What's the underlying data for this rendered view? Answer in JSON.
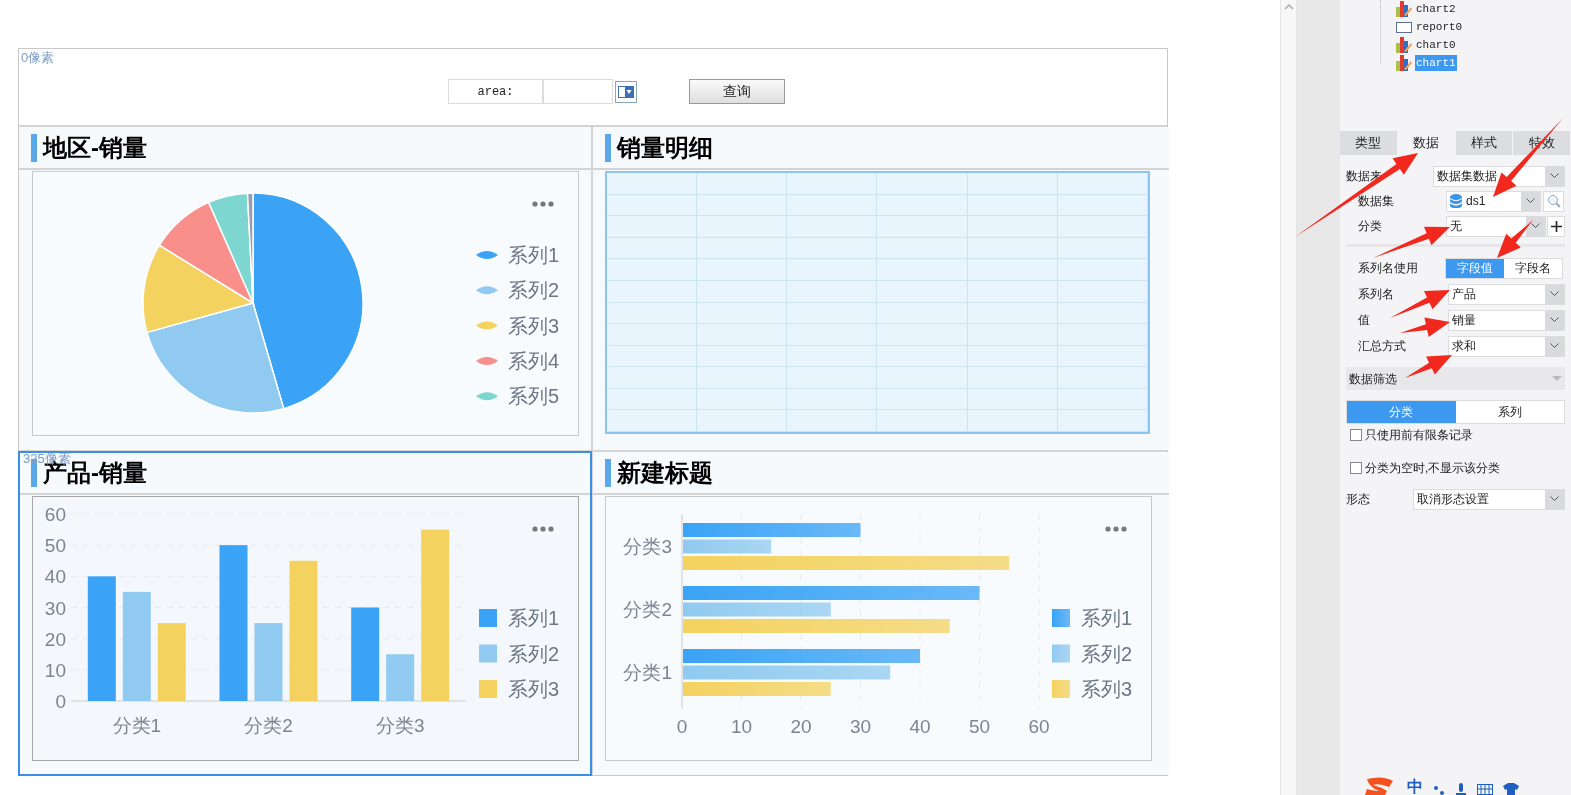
{
  "canvas": {
    "margin_labels": [
      "0像素",
      "325像素"
    ]
  },
  "filter": {
    "label": "area:",
    "button": "查询"
  },
  "panels": [
    {
      "kind": "pie",
      "title": "地区-销量",
      "selected": false,
      "legend": [
        {
          "label": "系列1",
          "color": "#3aa3f5"
        },
        {
          "label": "系列2",
          "color": "#90caf0"
        },
        {
          "label": "系列3",
          "color": "#f4d25f"
        },
        {
          "label": "系列4",
          "color": "#f98f8a"
        },
        {
          "label": "系列5",
          "color": "#7dd6cf"
        }
      ]
    },
    {
      "kind": "table",
      "title": "销量明细",
      "selected": false
    },
    {
      "kind": "chart",
      "title": "产品-销量",
      "selected": true,
      "chart_data": {
        "type": "bar",
        "grid": true,
        "legend": true,
        "categories": [
          "分类1",
          "分类2",
          "分类3"
        ],
        "series": [
          {
            "name": "系列1",
            "color": "#3aa3f5",
            "values": [
              40,
              50,
              30
            ]
          },
          {
            "name": "系列2",
            "color": "#90caf0",
            "values": [
              35,
              25,
              15
            ]
          },
          {
            "name": "系列3",
            "color": "#f4d25f",
            "values": [
              25,
              45,
              55
            ]
          }
        ],
        "ylim": [
          0,
          60
        ],
        "yticks": [
          0,
          10,
          20,
          30,
          40,
          50,
          60
        ]
      }
    },
    {
      "kind": "chart",
      "title": "新建标题",
      "selected": false,
      "chart_data": {
        "type": "bar",
        "orientation": "horizontal",
        "grid": true,
        "legend": true,
        "categories": [
          "分类3",
          "分类2",
          "分类1"
        ],
        "series": [
          {
            "name": "系列1",
            "color": "#3aa3f5",
            "values": [
              30,
              50,
              40
            ]
          },
          {
            "name": "系列2",
            "color": "#90caf0",
            "values": [
              15,
              25,
              35
            ]
          },
          {
            "name": "系列3",
            "color": "#f4d25f",
            "values": [
              55,
              45,
              25
            ]
          }
        ],
        "xlim": [
          0,
          60
        ],
        "xticks": [
          0,
          10,
          20,
          30,
          40,
          50,
          60
        ]
      }
    }
  ],
  "tree": [
    {
      "label": "chart2",
      "kind": "chart",
      "selected": false
    },
    {
      "label": "report0",
      "kind": "report",
      "selected": false
    },
    {
      "label": "chart0",
      "kind": "chart",
      "selected": false
    },
    {
      "label": "chart1",
      "kind": "chart",
      "selected": true
    }
  ],
  "tabs": [
    {
      "label": "类型",
      "selected": false
    },
    {
      "label": "数据",
      "selected": true
    },
    {
      "label": "样式",
      "selected": false
    },
    {
      "label": "特效",
      "selected": false
    }
  ],
  "data_form": {
    "source": {
      "label": "数据来",
      "value": "数据集数据"
    },
    "dataset": {
      "label": "数据集",
      "value": "ds1"
    },
    "category": {
      "label": "分类",
      "value": "无"
    },
    "series_name_use": {
      "label": "系列名使用",
      "options": [
        {
          "label": "字段值",
          "selected": true
        },
        {
          "label": "字段名",
          "selected": false
        }
      ]
    },
    "fields": [
      {
        "label": "系列名",
        "value": "产品"
      },
      {
        "label": "值",
        "value": "销量"
      },
      {
        "label": "汇总方式",
        "value": "求和"
      }
    ],
    "filter_title": "数据筛选",
    "filter_tabs": [
      {
        "label": "分类",
        "selected": true
      },
      {
        "label": "系列",
        "selected": false
      }
    ],
    "checkboxes": [
      {
        "label": "只使用前有限条记录",
        "checked": false
      },
      {
        "label": "分类为空时,不显示该分类",
        "checked": false
      }
    ],
    "shape": {
      "label": "形态",
      "value": "取消形态设置"
    }
  },
  "ime": {
    "label": "中"
  }
}
